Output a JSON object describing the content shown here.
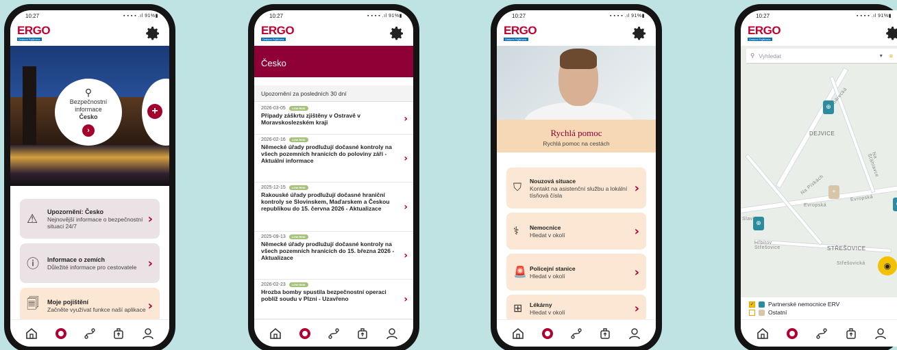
{
  "status_time": "10:27",
  "battery": "91%",
  "logo": {
    "word": "ERGO",
    "sub": "Cestovní Pojišťovna"
  },
  "phone1": {
    "info_circle": {
      "line1": "Bezpečnostní",
      "line2": "informace",
      "country": "Česko"
    },
    "cards": [
      {
        "title": "Upozornění: Česko",
        "desc": "Nejnovější informace o bezpečnostní situaci 24/7"
      },
      {
        "title": "Informace o zemích",
        "desc": "Důležité informace pro cestovatele"
      },
      {
        "title": "Moje pojištění",
        "desc": "Začněte využívat funkce naší aplikace"
      }
    ]
  },
  "phone2": {
    "title": "Česko",
    "section": "Upozornění za posledních 30 dní",
    "badge": "LOW RISK",
    "news": [
      {
        "date": "2026-03-05",
        "title": "Případy záškrtu zjištěny v Ostravě v Moravskoslezském kraji"
      },
      {
        "date": "2026-02-16",
        "title": "Německé úřady prodlužují dočasné kontroly na všech pozemních hranicích do poloviny září - Aktuální informace"
      },
      {
        "date": "2025-12-15",
        "title": "Rakouské úřady prodlužují dočasné hraniční kontroly se Slovinskem, Maďarskem a Českou republikou do 15. června 2026 - Aktualizace"
      },
      {
        "date": "2025-09-13",
        "title": "Německé úřady prodlužují dočasné kontroly na všech pozemních hranicích do 15. března 2026 - Aktualizace"
      },
      {
        "date": "2026-02-23",
        "title": "Hrozba bomby spustila bezpečnostní operaci poblíž soudu v Plzni - Uzavřeno"
      }
    ]
  },
  "phone3": {
    "heading": "Rychlá pomoc",
    "subheading": "Rychlá pomoc na cestách",
    "cards": [
      {
        "title": "Nouzová situace",
        "desc": "Kontakt na asistenční službu a lokální tísňová čísla"
      },
      {
        "title": "Nemocnice",
        "desc": "Hledat v okolí"
      },
      {
        "title": "Policejní stanice",
        "desc": "Hledat v okolí"
      },
      {
        "title": "Lékárny",
        "desc": "Hledat v okolí"
      }
    ]
  },
  "phone4": {
    "search_placeholder": "Vyhledat",
    "map_labels": {
      "dejvice": "DEJVICE",
      "stresovice": "STŘEŠOVICE",
      "evropska1": "Evropská",
      "evropska2": "Evropská",
      "na_pinkach": "Na Pískách",
      "sarecka": "Šárecká",
      "na_sumavce": "Na Šťáhlavce",
      "hrbitov": "Hřbitov Střešovice",
      "stresovicka": "Střešovická",
      "slavia": "Slavia"
    },
    "legend": [
      {
        "label": "Partnerské nemocnice ERV",
        "checked": true
      },
      {
        "label": "Ostatní",
        "checked": false
      }
    ]
  },
  "colors": {
    "brand": "#c0002f",
    "maroon": "#8e0036",
    "teal": "#2a8c9e",
    "yellow": "#f2c200"
  },
  "nav_icons": [
    "home-icon",
    "lifebuoy-icon",
    "route-icon",
    "luggage-icon",
    "profile-icon"
  ]
}
